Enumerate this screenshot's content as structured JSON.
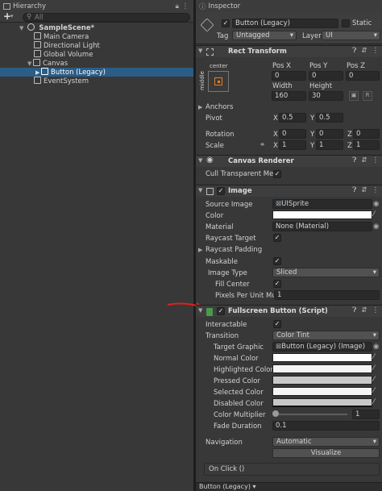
{
  "hierarchy": {
    "tab_label": "Hierarchy",
    "search_placeholder": "All",
    "add_label": "+",
    "items": [
      {
        "label": "SampleScene*"
      },
      {
        "label": "Main Camera"
      },
      {
        "label": "Directional Light"
      },
      {
        "label": "Global Volume"
      },
      {
        "label": "Canvas"
      },
      {
        "label": "Button (Legacy)",
        "selected": true
      },
      {
        "label": "EventSystem"
      }
    ]
  },
  "inspector": {
    "tab_label": "Inspector",
    "object_name": "Button (Legacy)",
    "static_label": "Static",
    "tag_label": "Tag",
    "tag_value": "Untagged",
    "layer_label": "Layer",
    "layer_value": "UI",
    "rect_transform": {
      "title": "Rect Transform",
      "anchor_h": "center",
      "anchor_v": "middle",
      "pos_x_label": "Pos X",
      "pos_x": "0",
      "pos_y_label": "Pos Y",
      "pos_y": "0",
      "pos_z_label": "Pos Z",
      "pos_z": "0",
      "width_label": "Width",
      "width": "160",
      "height_label": "Height",
      "height": "30",
      "anchors_label": "Anchors",
      "pivot_label": "Pivot",
      "pivot_x": "0.5",
      "pivot_y": "0.5",
      "rotation_label": "Rotation",
      "rot_x": "0",
      "rot_y": "0",
      "rot_z": "0",
      "scale_label": "Scale",
      "scale_x": "1",
      "scale_y": "1",
      "scale_z": "1",
      "raw_label": "R",
      "x": "X",
      "y": "Y",
      "z": "Z"
    },
    "canvas_renderer": {
      "title": "Canvas Renderer",
      "cull_label": "Cull Transparent Mes"
    },
    "image": {
      "title": "Image",
      "source_label": "Source Image",
      "source_value": "UISprite",
      "color_label": "Color",
      "material_label": "Material",
      "material_value": "None (Material)",
      "raycast_target_label": "Raycast Target",
      "raycast_padding_label": "Raycast Padding",
      "maskable_label": "Maskable",
      "image_type_label": "Image Type",
      "image_type_value": "Sliced",
      "fill_center_label": "Fill Center",
      "ppu_label": "Pixels Per Unit Mul",
      "ppu_value": "1"
    },
    "fullscreen_button": {
      "title": "Fullscreen Button (Script)",
      "interactable_label": "Interactable",
      "transition_label": "Transition",
      "transition_value": "Color Tint",
      "target_label": "Target Graphic",
      "target_value": "Button (Legacy) (Image)",
      "normal_label": "Normal Color",
      "highlighted_label": "Highlighted Color",
      "pressed_label": "Pressed Color",
      "selected_label": "Selected Color",
      "disabled_label": "Disabled Color",
      "multiplier_label": "Color Multiplier",
      "multiplier_value": "1",
      "fade_label": "Fade Duration",
      "fade_value": "0.1",
      "navigation_label": "Navigation",
      "navigation_value": "Automatic",
      "visualize_label": "Visualize",
      "onclick_label": "On Click ()"
    },
    "footer_label": "Button (Legacy) ▾"
  },
  "colors": {
    "selection": "#2c5d87",
    "annotation_arrow": "#e02020"
  }
}
